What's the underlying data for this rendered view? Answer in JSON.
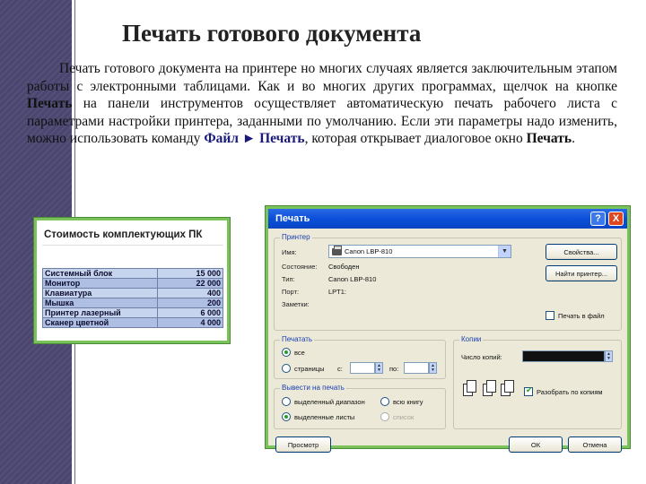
{
  "slide": {
    "title": "Печать готового документа",
    "paragraph": {
      "part1": "Печать готового документа на принтере но многих случаях является заключительным этапом работы с электронными таблицами. Как и во многих других программах, щелчок на кнопке ",
      "print_button_ref": "Печать",
      "part2": " на панели инструментов осуществляет автоматическую печать рабочего листа с параметрами настройки принтера, заданными по умолчанию. Если эти параметры надо изменить, можно использовать команду ",
      "menu_file": "Файл",
      "arrow": "►",
      "menu_print": "Печать",
      "part3": ", которая открывает диалоговое окно ",
      "dialog_ref": "Печать",
      "part4": "."
    }
  },
  "spreadsheet": {
    "title": "Стоимость комплектующих ПК",
    "rows": [
      {
        "name": "Системный блок",
        "value": "15 000"
      },
      {
        "name": "Монитор",
        "value": "22 000"
      },
      {
        "name": "Клавиатура",
        "value": "400"
      },
      {
        "name": "Мышка",
        "value": "200"
      },
      {
        "name": "Принтер лазерный",
        "value": "6 000"
      },
      {
        "name": "Сканер цветной",
        "value": "4 000"
      }
    ]
  },
  "dialog": {
    "title": "Печать",
    "help": "?",
    "close": "X",
    "printer_group": {
      "legend": "Принтер",
      "name_label": "Имя:",
      "name_value": "Canon LBP-810",
      "state_label": "Состояние:",
      "state_value": "Свободен",
      "type_label": "Тип:",
      "type_value": "Canon LBP-810",
      "port_label": "Порт:",
      "port_value": "LPT1:",
      "notes_label": "Заметки:",
      "notes_value": "",
      "properties_button": "Свойства...",
      "find_button": "Найти принтер...",
      "print_to_file": "Печать в файл"
    },
    "range_group": {
      "legend": "Печатать",
      "all": "все",
      "pages": "страницы",
      "from": "с:",
      "to": "по:"
    },
    "output_group": {
      "legend": "Вывести на печать",
      "selection": "выделенный диапазон",
      "whole_book": "всю книгу",
      "selected_sheets": "выделенные листы",
      "list": "список"
    },
    "copies_group": {
      "legend": "Копии",
      "count_label": "Число копий:",
      "collate": "Разобрать по копиям"
    },
    "buttons": {
      "preview": "Просмотр",
      "ok": "ОК",
      "cancel": "Отмена"
    }
  },
  "colors": {
    "sidebar": "#4a4670",
    "frame_green": "#7ac35a",
    "xp_title_blue": "#0b4fd8",
    "dialog_bg": "#ece9d8"
  }
}
